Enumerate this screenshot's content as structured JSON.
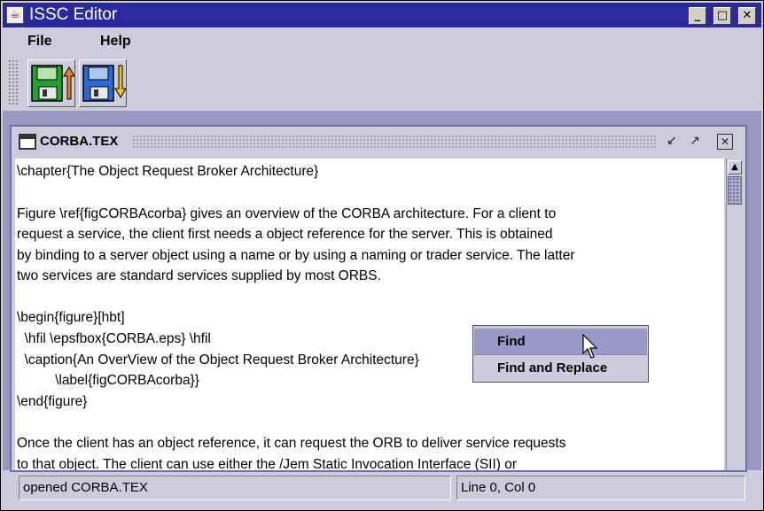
{
  "window": {
    "title": "ISSC Editor",
    "app_icon": "java-cup-icon",
    "controls": {
      "minimize": "_",
      "maximize": "□",
      "close": "✕"
    }
  },
  "menubar": {
    "items": [
      "File",
      "Help"
    ]
  },
  "toolbar": {
    "buttons": [
      {
        "name": "open-save-green",
        "icon": "floppy-upload-icon",
        "color": "#2fa02f"
      },
      {
        "name": "save-blue",
        "icon": "floppy-download-icon",
        "color": "#2f6fd0"
      }
    ]
  },
  "document": {
    "title": "CORBA.TEX",
    "controls": {
      "iconify": "↙",
      "maximize": "↗",
      "close": "✕"
    },
    "lines": [
      "\\chapter{The Object Request Broker Architecture}",
      "",
      "Figure \\ref{figCORBAcorba} gives an overview of the CORBA architecture. For a client to",
      "request a service, the client first needs a object reference for the server. This is obtained",
      "by binding to a server object using a name or by using a naming or trader service. The latter",
      "two services are standard services supplied by most ORBS.",
      "",
      "\\begin{figure}[hbt]",
      "  \\hfil \\epsfbox{CORBA.eps} \\hfil",
      "  \\caption{An OverView of the Object Request Broker Architecture}",
      "          \\label{figCORBAcorba}}",
      "\\end{figure}",
      "",
      "Once the client has an object reference, it can request the ORB to deliver service requests",
      "to that object. The client can use either the /Jem Static Invocation Interface (SII) or"
    ]
  },
  "context_menu": {
    "items": [
      {
        "label": "Find",
        "selected": true
      },
      {
        "label": "Find and Replace",
        "selected": false
      }
    ]
  },
  "status": {
    "message": "opened CORBA.TEX",
    "position": "Line 0, Col 0"
  },
  "colors": {
    "titlebar": "#2a2a9c",
    "desktop": "#9898c0",
    "selection": "#9a9ac8",
    "chrome": "#ccccdc"
  }
}
